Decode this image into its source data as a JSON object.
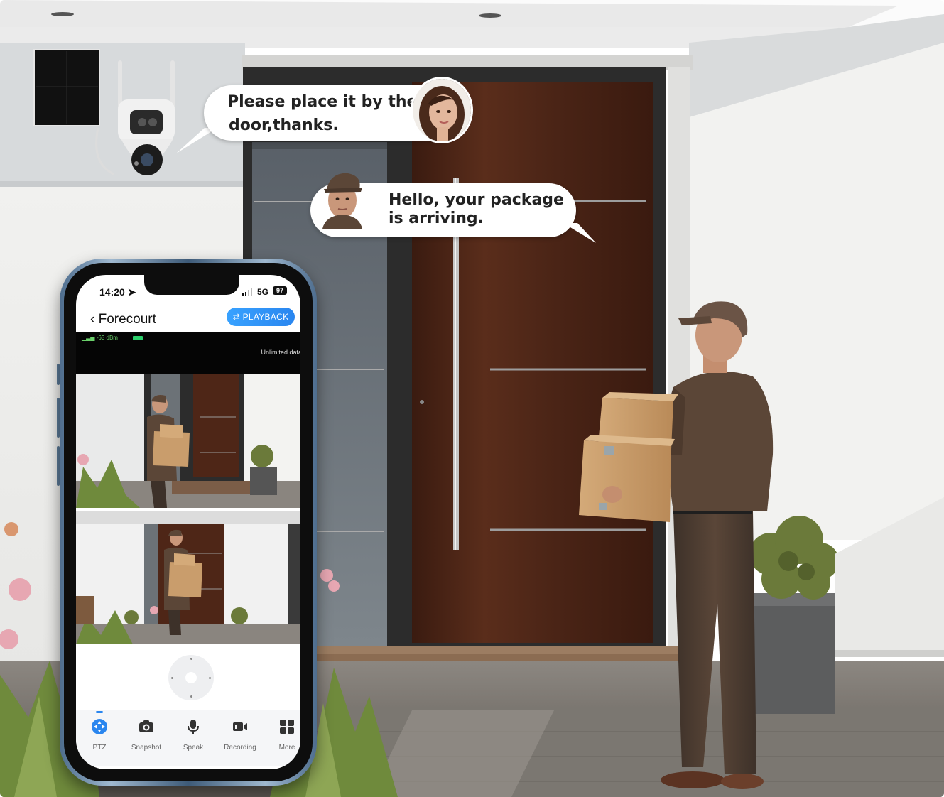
{
  "speech": {
    "woman": {
      "line1": "Please place it by the",
      "line2": "door,thanks."
    },
    "courier": {
      "line1": "Hello, your package",
      "line2": "is arriving."
    }
  },
  "app": {
    "status_bar": {
      "time": "14:20",
      "network": "5G",
      "battery": "97"
    },
    "title": "Forecourt",
    "playback_label": "PLAYBACK",
    "signal": "-63 dBm",
    "data_plan": "Unlimited data",
    "toolbar": [
      {
        "label": "PTZ",
        "icon": "ptz-icon",
        "active": true
      },
      {
        "label": "Snapshot",
        "icon": "camera-icon",
        "active": false
      },
      {
        "label": "Speak",
        "icon": "microphone-icon",
        "active": false
      },
      {
        "label": "Recording",
        "icon": "video-camera-icon",
        "active": false
      },
      {
        "label": "More",
        "icon": "grid-icon",
        "active": false
      }
    ]
  },
  "colors": {
    "accent": "#2a86ef",
    "door": "#4a2416",
    "uniform": "#5b4637",
    "box": "#c99d6c"
  }
}
